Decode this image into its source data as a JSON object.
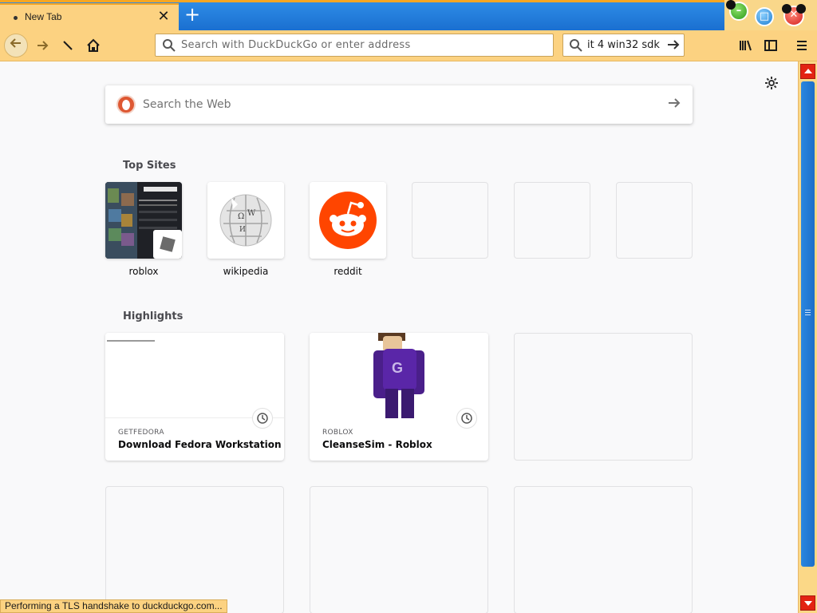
{
  "tab": {
    "title": "New Tab",
    "close": "✕",
    "new_tab": "+"
  },
  "window": {
    "minimize": "–",
    "maximize": "□",
    "close": "✕"
  },
  "toolbar": {
    "url_placeholder": "Search with DuckDuckGo or enter address",
    "search_value": "it 4 win32 sdk",
    "back_icon": "arrow-left-icon",
    "forward_icon": "arrow-right-icon",
    "stop_icon": "stop-icon",
    "home_icon": "home-icon"
  },
  "newtab": {
    "search_placeholder": "Search the Web",
    "top_sites_title": "Top Sites",
    "highlights_title": "Highlights",
    "top_sites": [
      {
        "label": "roblox"
      },
      {
        "label": "wikipedia"
      },
      {
        "label": "reddit"
      }
    ],
    "highlights": [
      {
        "source": "GETFEDORA",
        "title": "Download Fedora Workstation"
      },
      {
        "source": "ROBLOX",
        "title": "CleanseSim - Roblox"
      }
    ]
  },
  "status": {
    "text": "Performing a TLS handshake to duckduckgo.com..."
  },
  "colors": {
    "toolbar": "#fcd281",
    "tabstrip": "#1a6fd0",
    "scroll_thumb": "#2a87e0",
    "scroll_buttons": "#e32312"
  }
}
